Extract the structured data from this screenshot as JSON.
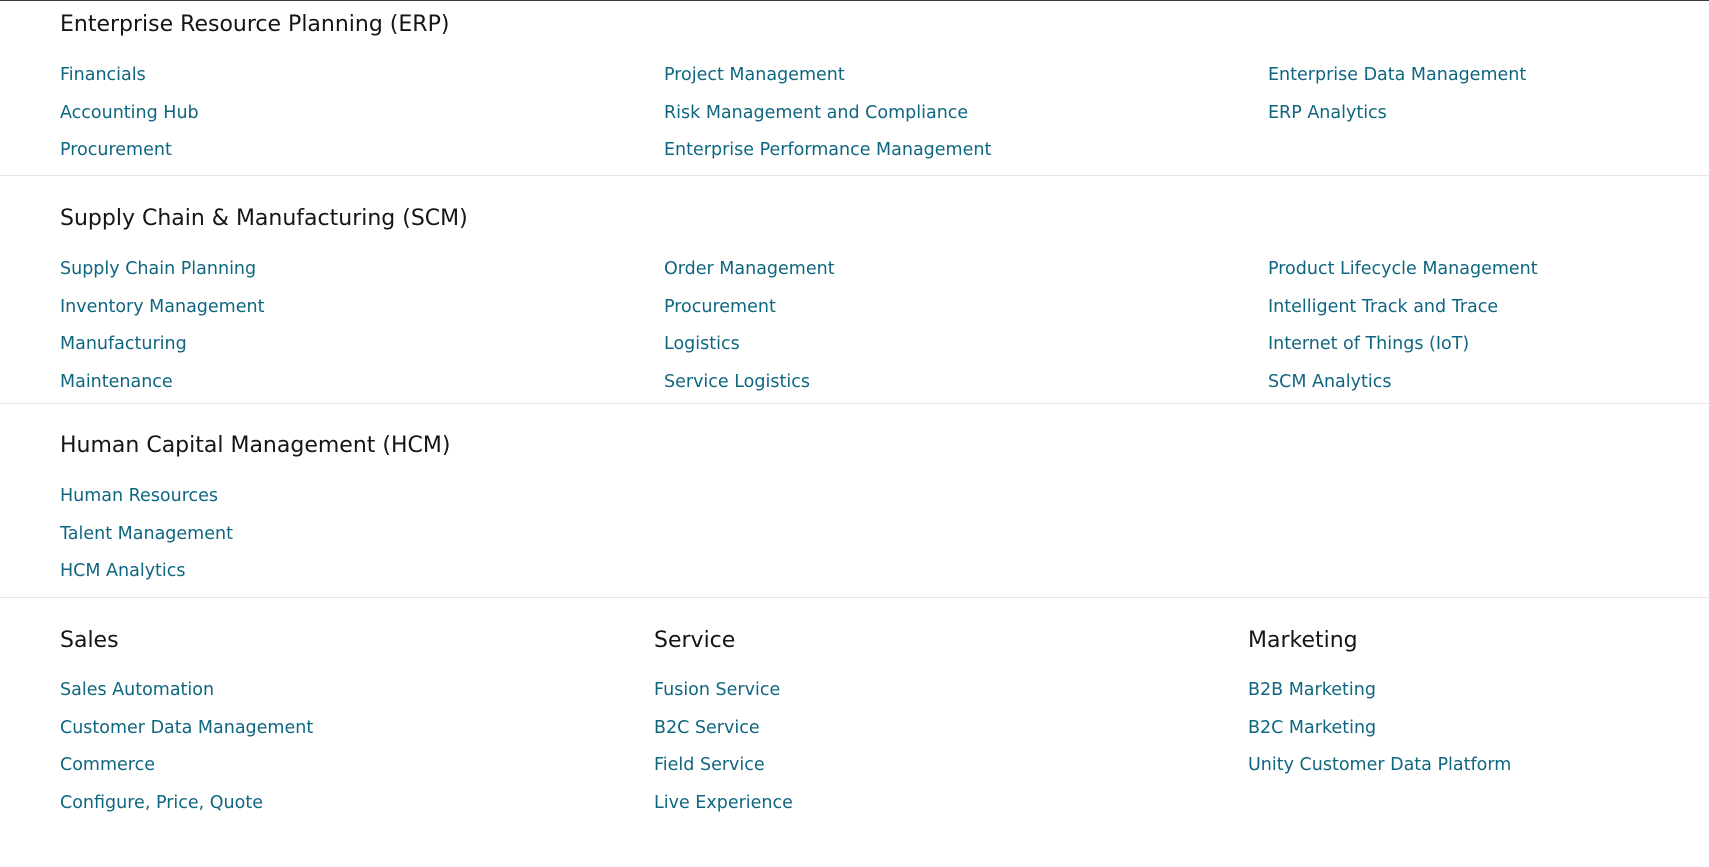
{
  "sections": {
    "erp": {
      "title": "Enterprise Resource Planning (ERP)",
      "col1": [
        "Financials",
        "Accounting Hub",
        "Procurement"
      ],
      "col2": [
        "Project Management",
        "Risk Management and Compliance",
        "Enterprise Performance Management"
      ],
      "col3": [
        "Enterprise Data Management",
        "ERP Analytics"
      ]
    },
    "scm": {
      "title": "Supply Chain & Manufacturing (SCM)",
      "col1": [
        "Supply Chain Planning",
        "Inventory Management",
        "Manufacturing",
        "Maintenance"
      ],
      "col2": [
        "Order Management",
        "Procurement",
        "Logistics",
        "Service Logistics"
      ],
      "col3": [
        "Product Lifecycle Management",
        "Intelligent Track and Trace",
        "Internet of Things (IoT)",
        "SCM Analytics"
      ]
    },
    "hcm": {
      "title": "Human Capital Management (HCM)",
      "col1": [
        "Human Resources",
        "Talent Management",
        "HCM Analytics"
      ]
    },
    "sales": {
      "title": "Sales",
      "items": [
        "Sales Automation",
        "Customer Data Management",
        "Commerce",
        "Configure, Price, Quote"
      ]
    },
    "service": {
      "title": "Service",
      "items": [
        "Fusion Service",
        "B2C Service",
        "Field Service",
        "Live Experience"
      ]
    },
    "marketing": {
      "title": "Marketing",
      "items": [
        "B2B Marketing",
        "B2C Marketing",
        "Unity Customer Data Platform"
      ]
    }
  }
}
